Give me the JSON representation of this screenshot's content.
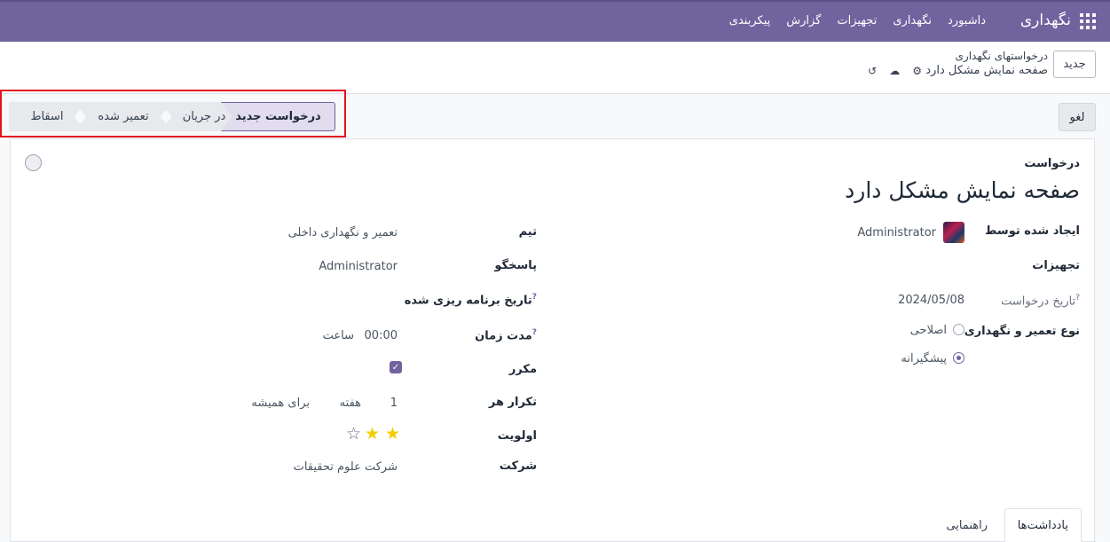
{
  "navbar": {
    "brand": "نگهداری",
    "menu": [
      "داشبورد",
      "نگهداری",
      "تجهیزات",
      "گزارش",
      "پیکربندی"
    ]
  },
  "control_panel": {
    "new_button": "جدید",
    "breadcrumb_parent": "درخواستهای نگهداری",
    "breadcrumb_current": "صفحه نمایش مشکل دارد",
    "icons": {
      "gear": "⚙",
      "save": "☁",
      "discard": "↺"
    }
  },
  "status_bar": {
    "cancel_button": "لغو",
    "stages": [
      "درخواست جدید",
      "در جریان",
      "تعمیر شده",
      "اسقاط"
    ],
    "active_stage": "درخواست جدید"
  },
  "form": {
    "title_label": "درخواست",
    "title_value": "صفحه نمایش مشکل دارد",
    "left": {
      "created_by_label": "ایجاد شده توسط",
      "created_by_value": "Administrator",
      "equipment_label": "تجهیزات",
      "request_date_label": "تاریخ درخواست",
      "request_date_value": "2024/05/08",
      "maintenance_type_label": "نوع تعمیر و نگهداری",
      "maintenance_type_options": [
        "اصلاحی",
        "پیشگیرانه"
      ],
      "maintenance_type_selected": "پیشگیرانه"
    },
    "right": {
      "team_label": "تیم",
      "team_value": "تعمیر و نگهداری داخلی",
      "responsible_label": "پاسخگو",
      "responsible_value": "Administrator",
      "scheduled_date_label": "تاریخ برنامه ریزی شده",
      "duration_label": "مدت زمان",
      "duration_value": "00:00",
      "duration_unit": "ساعت",
      "recurring_label": "مکرر",
      "recurring_checked": true,
      "repeat_every_label": "تکرار هر",
      "repeat_interval": "1",
      "repeat_unit": "هفته",
      "repeat_until": "برای همیشه",
      "priority_label": "اولویت",
      "priority_value": 2,
      "priority_max": 3,
      "company_label": "شرکت",
      "company_value": "شرکت علوم تحقیقات"
    },
    "tabs": [
      "یادداشت‌ها",
      "راهنمایی"
    ],
    "active_tab": "یادداشت‌ها",
    "help_mark": "?"
  },
  "colors": {
    "navbar": "#71639e",
    "accent": "#71639e",
    "star": "#f3cc00",
    "highlight": "#e0141e"
  }
}
